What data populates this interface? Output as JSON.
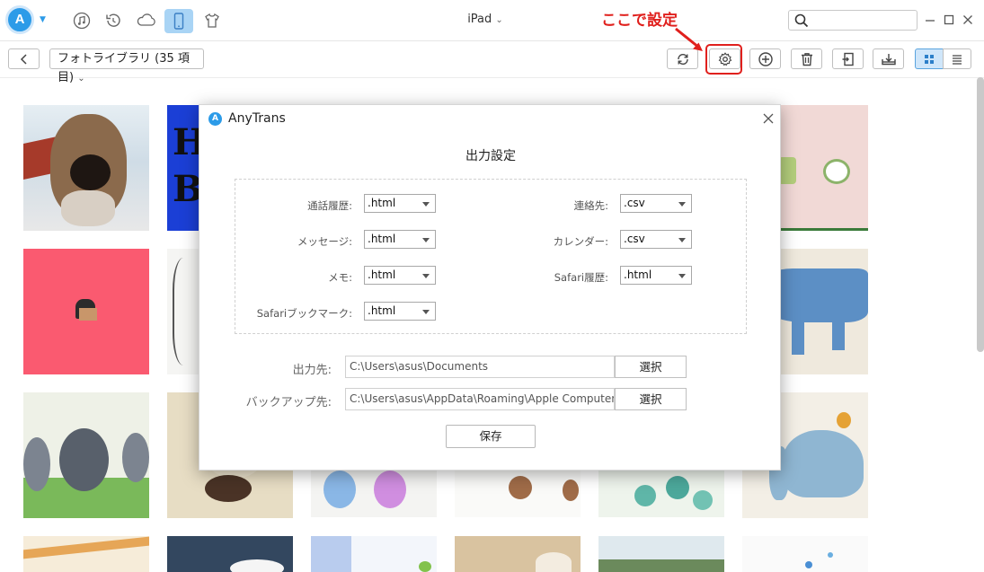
{
  "window": {
    "device_name": "iPad",
    "app_logo_letter": "A",
    "search": {
      "placeholder": "",
      "value": ""
    }
  },
  "nav_icons": [
    "music-icon",
    "history-icon",
    "cloud-icon",
    "device-icon",
    "tshirt-icon"
  ],
  "toolbar": {
    "album_label": "フォトライブラリ (35 項目)",
    "buttons": [
      "back-icon",
      "refresh-icon",
      "settings-icon",
      "add-icon",
      "delete-icon",
      "export-icon",
      "download-icon",
      "grid-view-icon",
      "list-view-icon"
    ]
  },
  "annotation": {
    "text": "ここで設定",
    "color": "#e0201d"
  },
  "dialog": {
    "app_name": "AnyTrans",
    "app_logo_letter": "A",
    "heading": "出力設定",
    "fields_left": [
      {
        "label": "通話履歴:",
        "value": ".html"
      },
      {
        "label": "メッセージ:",
        "value": ".html"
      },
      {
        "label": "メモ:",
        "value": ".html"
      },
      {
        "label": "Safariブックマーク:",
        "value": ".html"
      }
    ],
    "fields_right": [
      {
        "label": "連絡先:",
        "value": ".csv"
      },
      {
        "label": "カレンダー:",
        "value": ".csv"
      },
      {
        "label": "Safari履歴:",
        "value": ".html"
      }
    ],
    "output_label": "出力先:",
    "output_path": "C:\\Users\\asus\\Documents",
    "output_button": "選択",
    "backup_label": "バックアップ先:",
    "backup_path": "C:\\Users\\asus\\AppData\\Roaming\\Apple Computer",
    "backup_button": "選択",
    "save_button": "保存"
  },
  "colors": {
    "accent": "#2c9be8",
    "active_tab": "#a9d4f5",
    "annotation": "#e0201d"
  }
}
